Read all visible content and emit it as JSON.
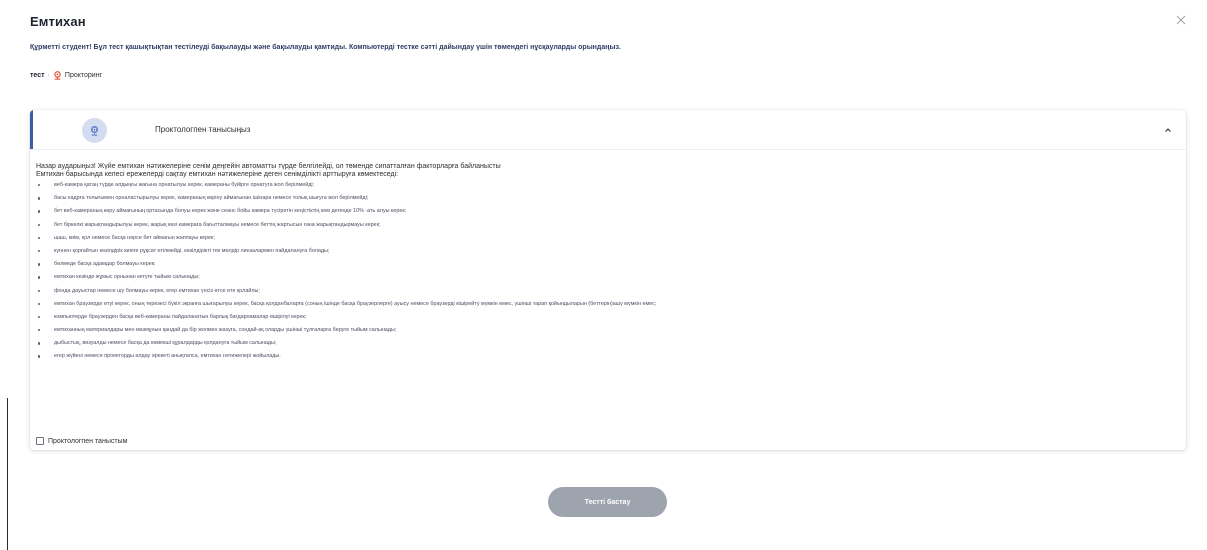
{
  "modal": {
    "title": "Емтихан",
    "close_icon": "close-icon",
    "intro": "Құрметті студент! Бұл тест қашықтықтан тестілеуді бақылауды және бақылауды қамтиды. Компьютерді тестке сәтті дайындау үшін төмендегі нұсқауларды орындаңыз."
  },
  "meta": {
    "test_label": "тест",
    "separator": "·",
    "proctoring_label": "Прокторинг",
    "proctoring_icon": "proctor-icon",
    "accent_color": "#e8532e"
  },
  "panel": {
    "title": "Проктологпен танысыңыз",
    "avatar_icon": "webcam-icon",
    "chevron_icon": "chevron-up-icon",
    "accent_color": "#3d5da5",
    "warning_line_1": "Назар аударыңыз! Жүйе емтихан нәтижелеріне сенім деңгейін автоматты түрде белгілейді, ол төменде сипатталған факторларға байланысты",
    "warning_line_2": "Емтихан барысында келесі ережелерді сақтау емтихан нәтижелеріне деген сенімділікті арттыруға көмектеседі:",
    "rules": [
      "веб-камера қатаң түрде алдыңғы жағына орнатылуы керек, камераны бүйірге орнатуға жол берілмейді;",
      "басы кадрға толығымен орналастырылуы керек, камераның көріну аймағынан ішінара немесе толық шығуға жол берілмейді;",
      "бет веб-камераның көру аймағының ортасында болуы керек және сеанс бойы камера түсіретін кеңістіктің кем дегенде 10% -ать алуы керек;",
      "бет біркелкі жарықтандырылуы керек, жарық көзі камераға бағытталмауы немесе беттің жартысын ғана жарықтандырмауы керек;",
      "шаш, киім, қол немесе басқа нәрсе бет аймағын жаппауы керек;",
      "күннен қорғайтын көзілдірік киюге рұқсат етілмейді, көзілдірікті тек мөлдір линзалармен пайдалануға болады;",
      "бөлмеде басқа адамдар болмауы керек;",
      "емтихан кезінде жұмыс орнынан кетуге тыйым салынады;",
      "фонда дауыстар немесе шу болмауы керек, егер емтихан үнсіз өтсе өте қолайлы;",
      "емтихан браузерде өтуі керек, оның терезесі бүкіл экранға шығарылуы керек, басқа қолданбаларға (соның ішінде басқа браузерлерге) ауысу немесе браузерді кішірейту мүмкін емес, үшінші тарап қойындыларын (беттерін)ашу мүмкін емес;",
      "компьютерде браузерден басқа веб-камераны пайдаланатын барлық бағдарламалар өшірілуі керек;",
      "емтиханның материалдары мен мазмұнын қандай да бір жолмен жазуға, сондай-ақ оларды үшінші тұлғаларға беруге тыйым салынады;",
      "дыбыстық, визуалды немесе басқа да көмекші құралдарды қолдануға тыйым салынады;",
      "егер жүйені немесе проекторды алдау әрекеті анықталса, емтихан нәтижелері жойылады."
    ],
    "agree_label": "Проктологпен таныстым",
    "agree_checked": false
  },
  "actions": {
    "start_label": "Тестті бастау",
    "start_color": "#9ea4ad"
  }
}
